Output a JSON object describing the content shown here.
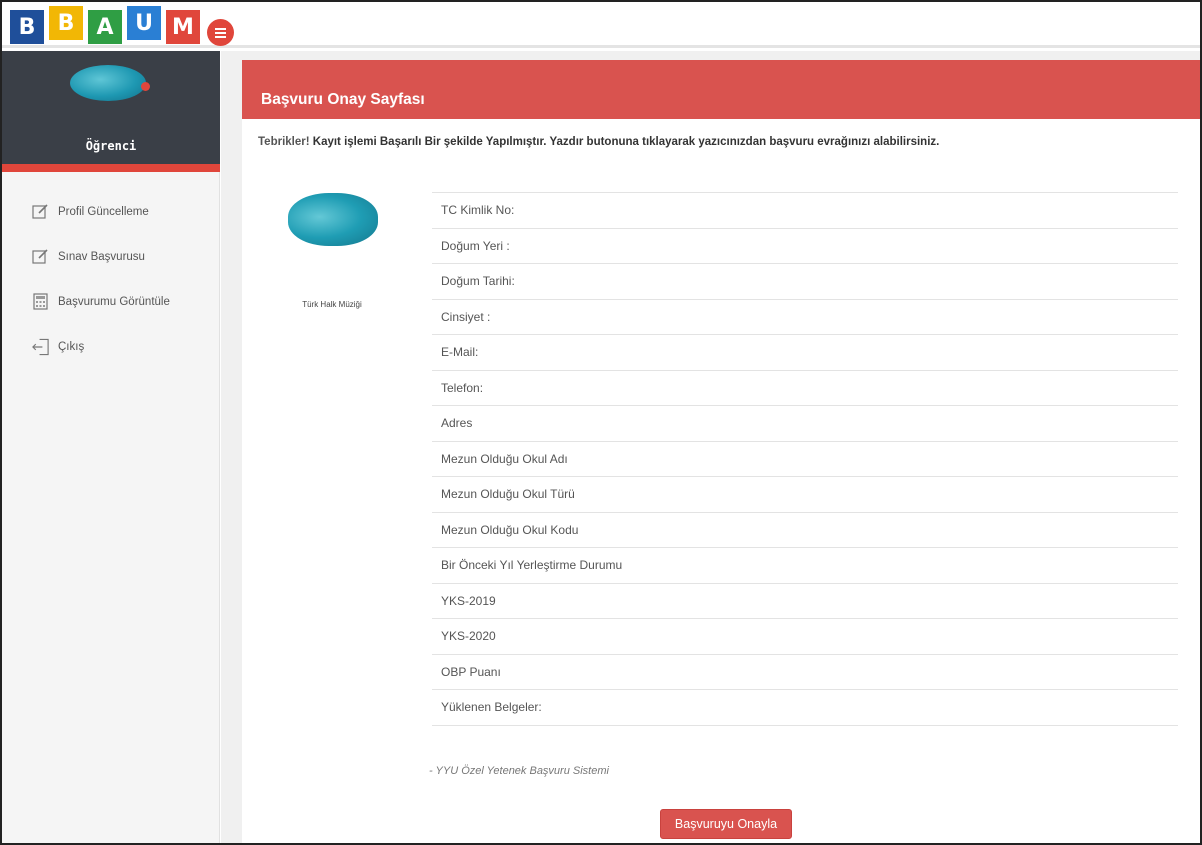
{
  "header": {
    "logo_letters": [
      "B",
      "B",
      "A",
      "U",
      "M"
    ],
    "menu_icon": "hamburger-menu-icon"
  },
  "sidebar": {
    "profile_name": "Öğrenci",
    "items": [
      {
        "label": "Profil Güncelleme",
        "icon": "edit-icon"
      },
      {
        "label": "Sınav Başvurusu",
        "icon": "edit-icon"
      },
      {
        "label": "Başvurumu Görüntüle",
        "icon": "calculator-icon"
      },
      {
        "label": "Çıkış",
        "icon": "sign-out-icon"
      }
    ]
  },
  "panel": {
    "title": "Başvuru Onay Sayfası",
    "congrats_prefix": "Tebrikler!",
    "congrats_text": " Kayıt işlemi Başarılı Bir şekilde Yapılmıştır. Yazdır butonuna tıklayarak yazıcınızdan başvuru evrağınızı alabilirsiniz.",
    "department": "Türk Halk Müziği",
    "fields": [
      "TC Kimlik No:",
      "Doğum Yeri :",
      "Doğum Tarihi:",
      "Cinsiyet :",
      "E-Mail:",
      "Telefon:",
      "Adres",
      "Mezun Olduğu Okul Adı",
      "Mezun Olduğu Okul Türü",
      "Mezun Olduğu Okul Kodu",
      "Bir Önceki Yıl Yerleştirme Durumu",
      "YKS-2019",
      "YKS-2020",
      "OBP Puanı",
      "Yüklenen Belgeler:"
    ],
    "footer_note": "- YYU Özel Yetenek Başvuru Sistemi",
    "confirm_button": "Başvuruyu Onayla"
  },
  "colors": {
    "accent_red": "#d9534f",
    "sidebar_dark": "#3a3f47"
  }
}
